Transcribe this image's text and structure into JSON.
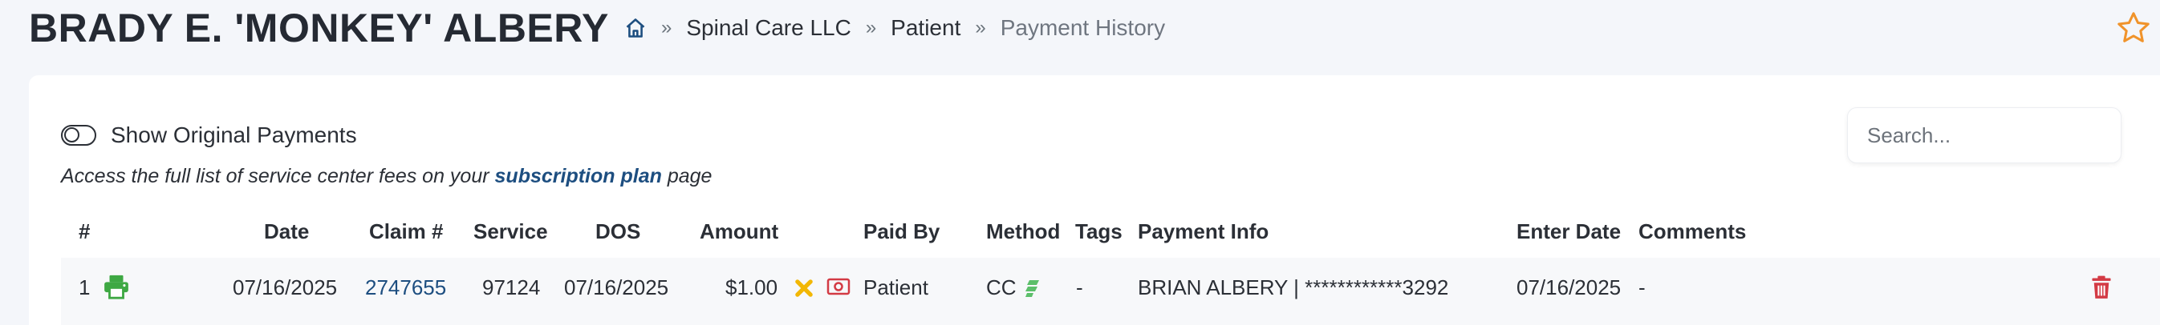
{
  "header": {
    "patient_name": "BRADY E. 'MONKEY' ALBERY",
    "breadcrumb": {
      "items": [
        "Spinal Care LLC",
        "Patient"
      ],
      "current": "Payment History",
      "separator": "»"
    }
  },
  "toolbar": {
    "toggle_label": "Show Original Payments",
    "toggle_on": false,
    "search": {
      "placeholder": "Search...",
      "value": ""
    }
  },
  "info": {
    "prefix": "Access the full list of service center fees on your",
    "link": "subscription plan",
    "suffix": "page"
  },
  "table": {
    "columns": [
      "#",
      "Date",
      "Claim #",
      "Service",
      "DOS",
      "Amount",
      "Paid By",
      "Method",
      "Tags",
      "Payment Info",
      "Enter Date",
      "Comments"
    ],
    "rows": [
      {
        "num": "1",
        "date": "07/16/2025",
        "claim": "2747655",
        "service": "97124",
        "dos": "07/16/2025",
        "amount": "$1.00",
        "paid_by": "Patient",
        "method": "CC",
        "tags": "-",
        "payment_info": "BRIAN ALBERY | ************3292",
        "enter_date": "07/16/2025",
        "comments": "-"
      }
    ]
  },
  "icons": {
    "home": "home-icon",
    "favorite": "star-outline-icon",
    "print": "printer-icon",
    "void": "x-icon",
    "cash": "money-bill-icon",
    "stripe": "stripe-icon",
    "delete": "trash-icon"
  },
  "colors": {
    "link": "#1d4e80",
    "star": "#f0932b",
    "print": "#3ea843",
    "void": "#f2b705",
    "cash": "#d33a44",
    "stripe": "#5cbf6a",
    "delete": "#d33a44",
    "row_bg": "#f7f8fa"
  }
}
